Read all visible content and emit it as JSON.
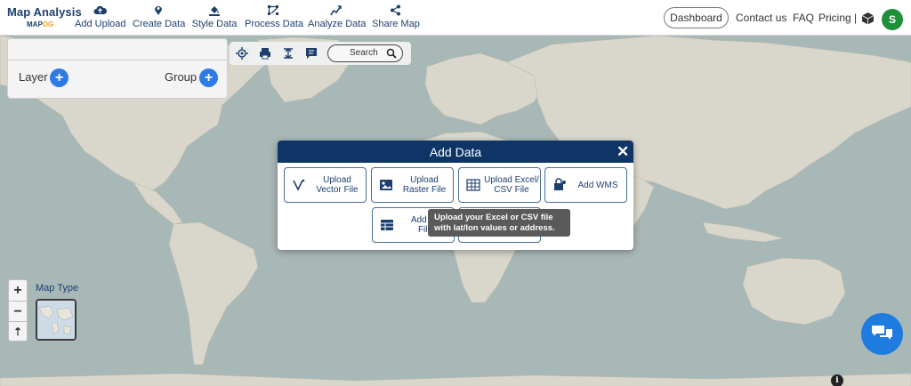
{
  "brand": {
    "title": "Map Analysis",
    "logo_left": "MAP",
    "logo_right": "OG"
  },
  "nav": [
    {
      "label": "Add Upload",
      "icon": "cloud-upload-icon"
    },
    {
      "label": "Create Data",
      "icon": "map-pin-icon"
    },
    {
      "label": "Style Data",
      "icon": "paint-bucket-icon"
    },
    {
      "label": "Process Data",
      "icon": "process-nodes-icon"
    },
    {
      "label": "Analyze Data",
      "icon": "analyze-chart-icon"
    },
    {
      "label": "Share Map",
      "icon": "share-icon"
    }
  ],
  "top_right": {
    "dashboard": "Dashboard",
    "contact": "Contact us",
    "faq": "FAQ",
    "pricing": "Pricing |",
    "avatar": "S"
  },
  "layer_panel": {
    "layer_label": "Layer",
    "group_label": "Group",
    "plus": "+"
  },
  "toolbar": {
    "search_label": "Search"
  },
  "zoom": {
    "in": "+",
    "out": "−",
    "reset": "⇡"
  },
  "map_type": {
    "label": "Map Type"
  },
  "modal": {
    "title": "Add Data",
    "close": "✕",
    "options": [
      {
        "line1": "Upload",
        "line2": "Vector File",
        "icon": "vector-icon"
      },
      {
        "line1": "Upload",
        "line2": "Raster File",
        "icon": "raster-image-icon"
      },
      {
        "line1": "Upload Excel/",
        "line2": "CSV File",
        "icon": "spreadsheet-icon"
      },
      {
        "line1": "Add WMS",
        "line2": "",
        "icon": "wms-lock-icon"
      },
      {
        "line1": "Add Ex",
        "line2": "File",
        "icon": "table-icon"
      }
    ]
  },
  "tooltip": {
    "line1": "Upload your Excel or CSV file",
    "line2": "with lat/lon values or address."
  },
  "info": "i",
  "colors": {
    "navy": "#0e3566",
    "accent_blue": "#2e7be6",
    "avatar_green": "#1f8f3a",
    "chat_blue": "#1e7be0"
  }
}
